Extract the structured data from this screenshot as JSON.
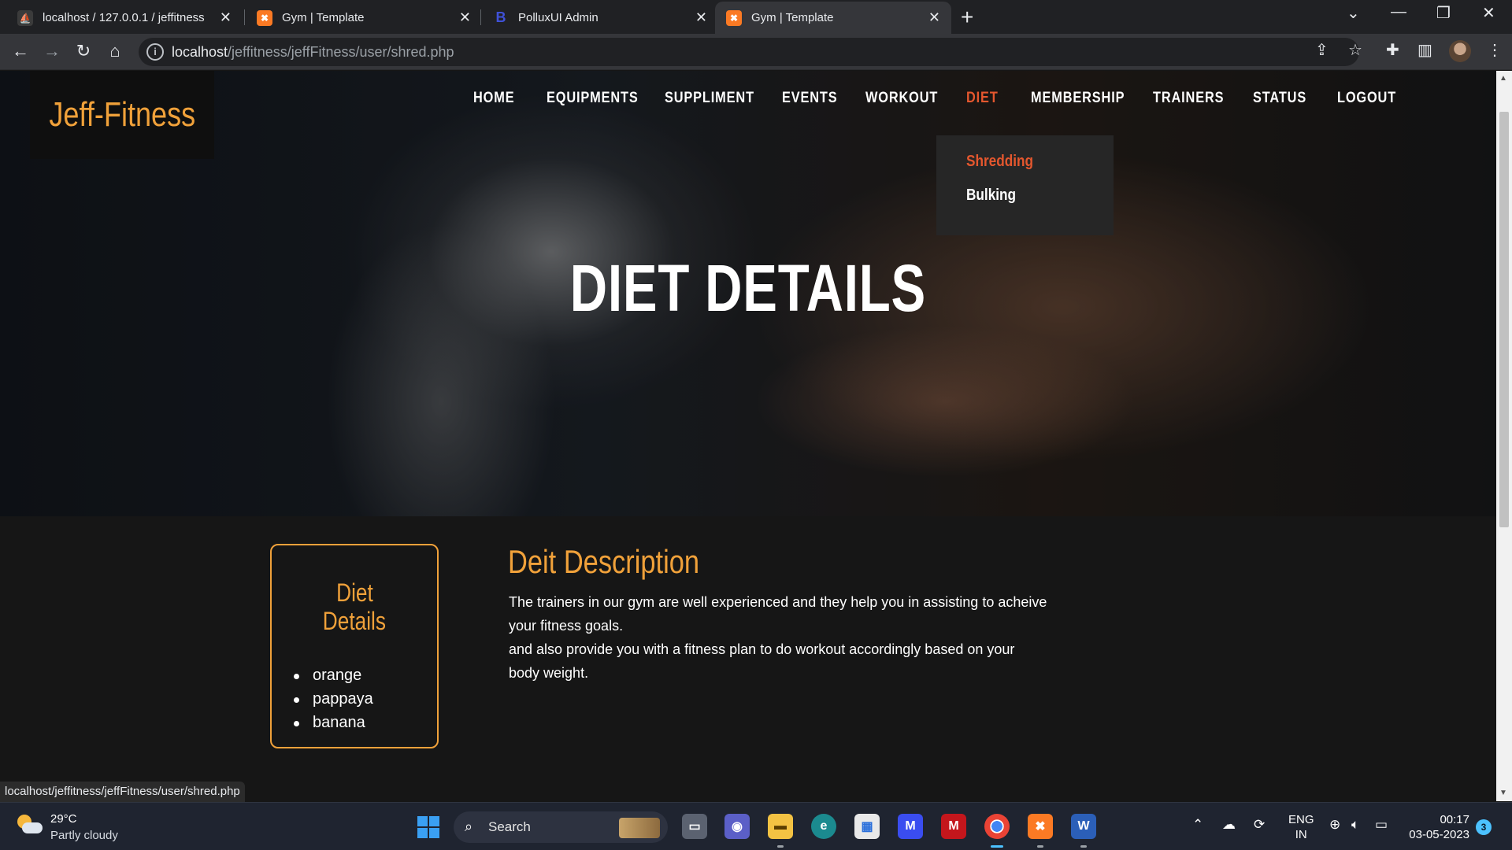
{
  "browser": {
    "tabs": [
      {
        "title": "localhost / 127.0.0.1 / jeffitness",
        "favicon": "phpmyadmin-icon"
      },
      {
        "title": "Gym | Template",
        "favicon": "xampp-icon"
      },
      {
        "title": "PolluxUI Admin",
        "favicon": "bootstrap-icon"
      },
      {
        "title": "Gym | Template",
        "favicon": "xampp-icon"
      }
    ],
    "active_tab_index": 3,
    "url_host": "localhost",
    "url_path": "/jeffitness/jeffFitness/user/shred.php",
    "status_url": "localhost/jeffitness/jeffFitness/user/shred.php"
  },
  "site": {
    "logo": "Jeff-Fitness",
    "nav": [
      "HOME",
      "EQUIPMENTS",
      "SUPPLIMENT",
      "EVENTS",
      "WORKOUT",
      "DIET",
      "MEMBERSHIP",
      "TRAINERS",
      "STATUS",
      "LOGOUT"
    ],
    "active_nav": "DIET",
    "dropdown": [
      "Shredding",
      "Bulking"
    ],
    "active_dropdown": "Shredding",
    "hero_title": "DIET DETAILS"
  },
  "diet_card": {
    "title_line1": "Diet",
    "title_line2": "Details",
    "items": [
      "orange",
      "pappaya",
      "banana"
    ]
  },
  "description": {
    "title": "Deit Description",
    "line1": "The trainers in our gym are well experienced and they help you in assisting to acheive",
    "line2": "your fitness goals.",
    "line3": "and also provide you with a fitness plan to do workout accordingly based on your",
    "line4": "body weight."
  },
  "taskbar": {
    "temperature": "29°C",
    "condition": "Partly cloudy",
    "search_label": "Search",
    "lang_line1": "ENG",
    "lang_line2": "IN",
    "time": "00:17",
    "date": "03-05-2023",
    "notification_count": "3"
  },
  "colors": {
    "accent_orange": "#f0a13a",
    "active_red": "#e4572e",
    "background": "#161616"
  }
}
